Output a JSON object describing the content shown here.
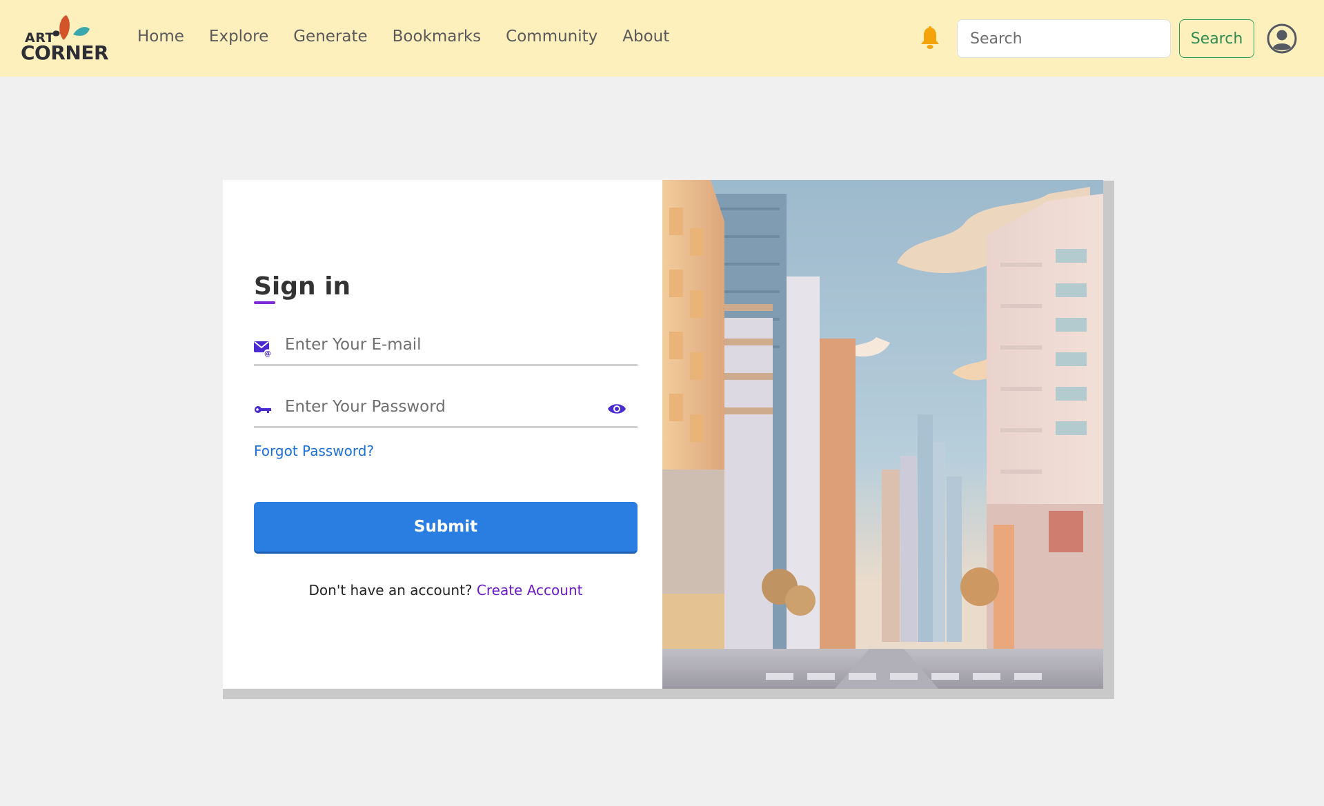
{
  "brand": {
    "logo_top": "ART",
    "logo_bottom": "CORNER"
  },
  "nav": {
    "links": [
      "Home",
      "Explore",
      "Generate",
      "Bookmarks",
      "Community",
      "About"
    ]
  },
  "header": {
    "search_placeholder": "Search",
    "search_button": "Search",
    "icons": {
      "notification": "bell-icon",
      "profile": "user-circle-icon"
    }
  },
  "signin": {
    "title": "Sign in",
    "email_placeholder": "Enter Your E-mail",
    "password_placeholder": "Enter Your Password",
    "forgot_password": "Forgot Password?",
    "submit": "Submit",
    "no_account_text": "Don't have an account?",
    "create_account": "Create Account",
    "icons": {
      "email": "envelope-at-icon",
      "password": "key-icon",
      "toggle_visibility": "eye-icon"
    }
  },
  "hero_image": {
    "description_icon": "city-street-illustration"
  },
  "colors": {
    "navbar_bg": "#fdf0bd",
    "page_bg": "#f0f0f0",
    "submit_bg": "#2a7de1",
    "accent_purple": "#6a19c9",
    "search_button_green": "#2e8b50",
    "bell_orange": "#f5a30a"
  }
}
